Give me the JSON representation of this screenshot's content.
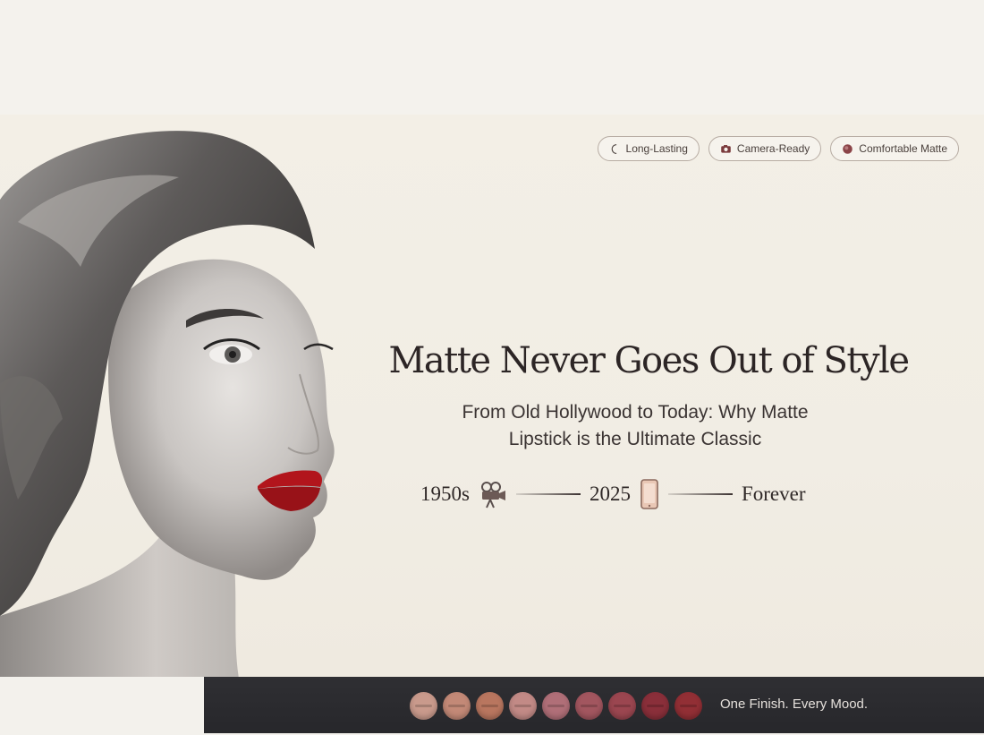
{
  "badges": [
    {
      "label": "Long-Lasting",
      "icon": "crescent-icon"
    },
    {
      "label": "Camera-Ready",
      "icon": "camera-icon"
    },
    {
      "label": "Comfortable Matte",
      "icon": "lipstick-dot-icon"
    }
  ],
  "headline": "Matte Never Goes Out of Style",
  "subhead": {
    "line1": "From Old Hollywood to Today: Why Matte",
    "line2": "Lipstick is the Ultimate Classic"
  },
  "timeline": {
    "start": "1950s",
    "middle": "2025",
    "end": "Forever",
    "icons": [
      "film-camera-icon",
      "smartphone-icon"
    ]
  },
  "footer": {
    "tagline": "One Finish. Every Mood.",
    "swatch_colors": [
      "#c99a8c",
      "#c38977",
      "#b9765f",
      "#c28a86",
      "#b06f78",
      "#a2565f",
      "#9b4650",
      "#8a2f3a",
      "#922f35"
    ]
  },
  "colors": {
    "accent_red": "#b2151c",
    "background": "#f3efe6",
    "footer_bar": "#2c2c30"
  }
}
